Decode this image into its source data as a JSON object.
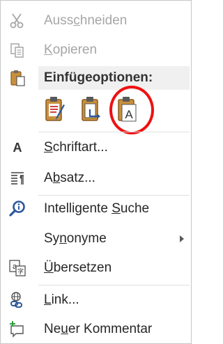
{
  "menu": {
    "cut": {
      "label_pre": "Auss",
      "label_key": "c",
      "label_post": "hneiden",
      "icon": "scissors-icon"
    },
    "copy": {
      "label_pre": "",
      "label_key": "K",
      "label_post": "opieren",
      "icon": "copy-icon"
    },
    "paste_options": {
      "label": "Einfügeoptionen:",
      "icon": "clipboard-icon",
      "options": [
        {
          "name": "keep-source-formatting",
          "icon": "paste-keep-formatting-icon"
        },
        {
          "name": "merge-formatting",
          "icon": "paste-merge-formatting-icon"
        },
        {
          "name": "keep-text-only",
          "icon": "paste-text-only-icon",
          "highlighted": true
        }
      ]
    },
    "font": {
      "label_pre": "",
      "label_key": "S",
      "label_post": "chriftart...",
      "icon": "font-icon",
      "icon_glyph": "A"
    },
    "paragraph": {
      "label_pre": "A",
      "label_key": "b",
      "label_post": "satz...",
      "icon": "paragraph-icon"
    },
    "smart_lookup": {
      "label_pre": "Intelligente ",
      "label_key": "S",
      "label_post": "uche",
      "icon": "smart-lookup-icon"
    },
    "synonyms": {
      "label_pre": "Sy",
      "label_key": "n",
      "label_post": "onyme",
      "has_submenu": true
    },
    "translate": {
      "label_pre": "",
      "label_key": "Ü",
      "label_post": "bersetzen",
      "icon": "translate-icon"
    },
    "link": {
      "label_pre": "",
      "label_key": "L",
      "label_post": "ink...",
      "icon": "link-icon"
    },
    "new_comment": {
      "label_pre": "Ne",
      "label_key": "u",
      "label_post": "er Kommentar",
      "icon": "new-comment-icon"
    }
  },
  "colors": {
    "accent_blue": "#2b579a",
    "highlight_red": "#ee1111",
    "disabled_text": "#a6a6a6"
  }
}
